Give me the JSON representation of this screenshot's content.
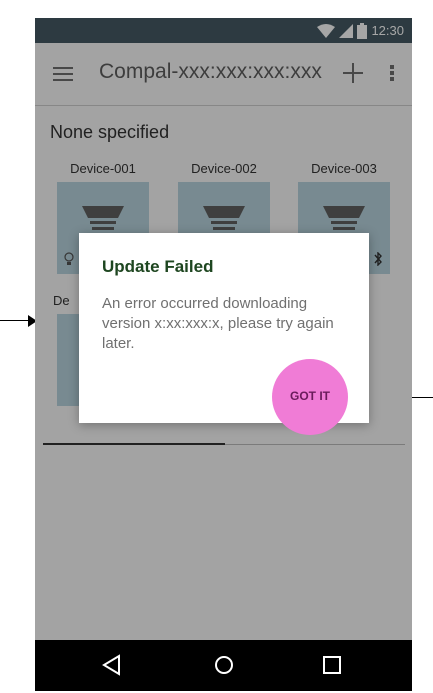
{
  "status_bar": {
    "time": "12:30",
    "icons": [
      "wifi-icon",
      "signal-icon",
      "battery-icon"
    ]
  },
  "app_bar": {
    "menu_icon": "menu-icon",
    "title": "Compal-xxx:xxx:xxx:xxx",
    "add_icon": "add-icon",
    "more_icon": "more-vert-icon"
  },
  "content": {
    "section_title": "None specified",
    "devices": [
      {
        "label": "Device-001",
        "icon": "lamp-icon"
      },
      {
        "label": "Device-002",
        "icon": "lamp-icon"
      },
      {
        "label": "Device-003",
        "icon": "lamp-icon"
      },
      {
        "label": "De",
        "icon": "lamp-icon"
      }
    ]
  },
  "dialog": {
    "title": "Update Failed",
    "body": "An error occurred downloading version x:xx:xxx:x, please try again later.",
    "button": "GOT IT"
  },
  "nav_bar": {
    "items": [
      "back-icon",
      "home-icon",
      "recents-icon"
    ]
  },
  "colors": {
    "status_bar": "#455a64",
    "tile": "#b8d4df",
    "dialog_title": "#1e4620",
    "highlight": "#f07cd6",
    "button_text": "#6a1b5b"
  }
}
